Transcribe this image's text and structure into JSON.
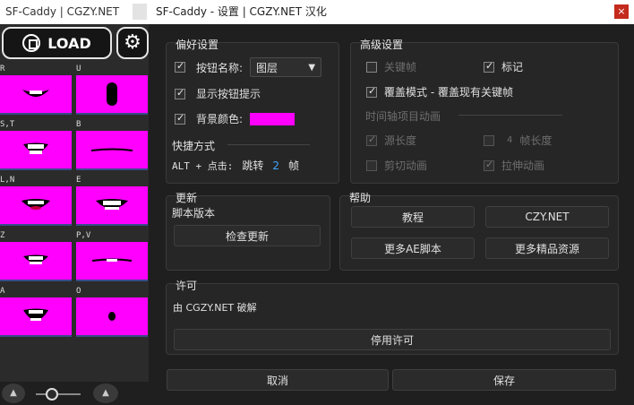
{
  "left_panel": {
    "title": "SF-Caddy | CGZY.NET",
    "load_label": "LOAD",
    "mouths": [
      {
        "label": "R"
      },
      {
        "label": "U"
      },
      {
        "label": "S,T"
      },
      {
        "label": "B"
      },
      {
        "label": "L,N"
      },
      {
        "label": "E"
      },
      {
        "label": "Z"
      },
      {
        "label": "P,V"
      },
      {
        "label": "A"
      },
      {
        "label": "O"
      }
    ],
    "mouth_color": "#ff00ff"
  },
  "dialog": {
    "title": "SF-Caddy - 设置 | CGZY.NET 汉化",
    "close": "×",
    "preferences": {
      "title": "偏好设置",
      "button_name_label": "按钮名称:",
      "button_name_value": "图层",
      "show_tooltips": "显示按钮提示",
      "bg_color_label": "背景颜色:",
      "bg_color": "#ff00ff",
      "shortcut_title": "快捷方式",
      "shortcut_prefix": "ALT + 点击:",
      "shortcut_action": "跳转",
      "shortcut_value": "2",
      "shortcut_unit": "帧"
    },
    "advanced": {
      "title": "高级设置",
      "keyframes": "关键帧",
      "markers": "标记",
      "overwrite": "覆盖模式 - 覆盖现有关键帧",
      "timeline_anim": "时间轴项目动画",
      "source_length": "源长度",
      "frames_value": "4",
      "frame_length": "帧长度",
      "cut_anim": "剪切动画",
      "stretch_anim": "拉伸动画"
    },
    "update": {
      "title": "更新",
      "version_label": "脚本版本",
      "check_button": "检查更新"
    },
    "help": {
      "title": "帮助",
      "tutorial": "教程",
      "czy": "CZY.NET",
      "more_scripts": "更多AE脚本",
      "more_resources": "更多精品资源"
    },
    "license": {
      "title": "许可",
      "text": "由 CGZY.NET 破解",
      "disable_button": "停用许可"
    },
    "cancel": "取消",
    "save": "保存"
  }
}
